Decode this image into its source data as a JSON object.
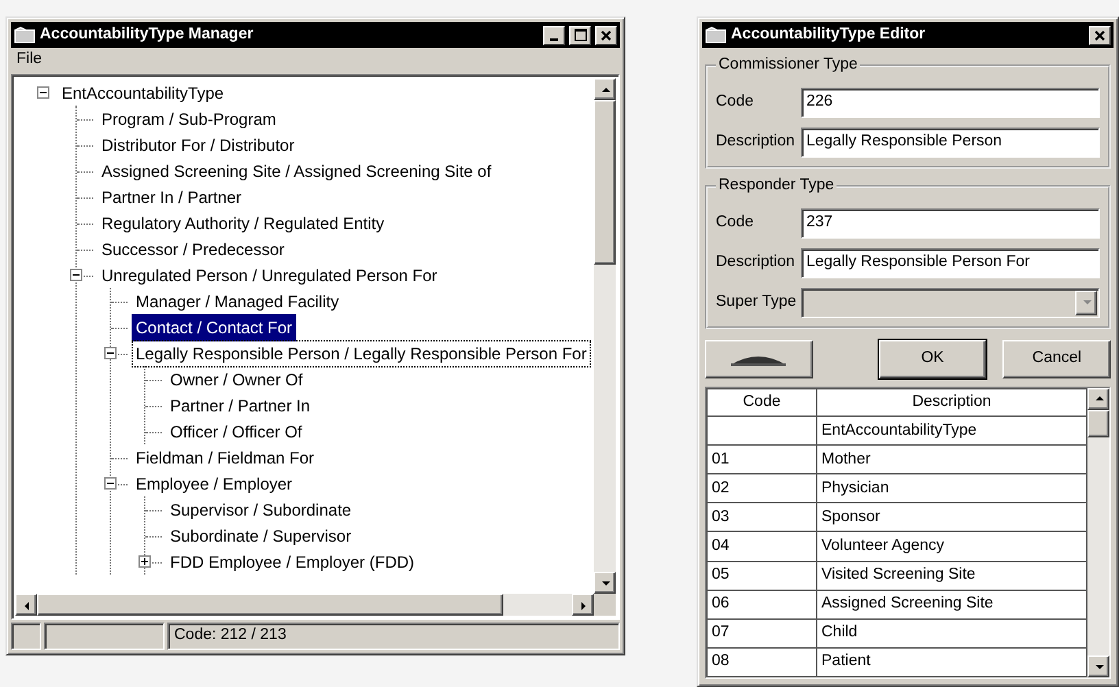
{
  "manager": {
    "title": "AccountabilityType Manager",
    "menu": [
      "File"
    ],
    "tree": [
      {
        "label": "EntAccountabilityType",
        "expanded": true,
        "selected": false,
        "focused": false,
        "children": [
          {
            "label": "Program / Sub-Program",
            "selected": false,
            "focused": false
          },
          {
            "label": "Distributor For / Distributor",
            "selected": false,
            "focused": false
          },
          {
            "label": "Assigned Screening Site / Assigned Screening Site of",
            "selected": false,
            "focused": false
          },
          {
            "label": "Partner In / Partner",
            "selected": false,
            "focused": false
          },
          {
            "label": "Regulatory Authority / Regulated Entity",
            "selected": false,
            "focused": false
          },
          {
            "label": "Successor / Predecessor",
            "selected": false,
            "focused": false
          },
          {
            "label": "Unregulated Person / Unregulated Person For",
            "expanded": true,
            "selected": false,
            "focused": false,
            "children": [
              {
                "label": "Manager / Managed Facility",
                "selected": false,
                "focused": false
              },
              {
                "label": "Contact / Contact For",
                "selected": true,
                "focused": false
              },
              {
                "label": "Legally Responsible Person / Legally Responsible Person For",
                "expanded": true,
                "selected": false,
                "focused": true,
                "children": [
                  {
                    "label": "Owner / Owner Of",
                    "selected": false,
                    "focused": false
                  },
                  {
                    "label": "Partner / Partner In",
                    "selected": false,
                    "focused": false
                  },
                  {
                    "label": "Officer / Officer Of",
                    "selected": false,
                    "focused": false
                  }
                ]
              },
              {
                "label": "Fieldman / Fieldman For",
                "selected": false,
                "focused": false
              },
              {
                "label": "Employee / Employer",
                "expanded": true,
                "selected": false,
                "focused": false,
                "children": [
                  {
                    "label": "Supervisor / Subordinate",
                    "selected": false,
                    "focused": false
                  },
                  {
                    "label": "Subordinate / Supervisor",
                    "selected": false,
                    "focused": false
                  },
                  {
                    "label": "FDD Employee / Employer (FDD)",
                    "expanded": false,
                    "selected": false,
                    "focused": false
                  }
                ]
              }
            ]
          }
        ]
      }
    ],
    "status_bar": {
      "code": "Code: 212 / 213"
    }
  },
  "editor": {
    "title": "AccountabilityType Editor",
    "groups": [
      {
        "legend": "Commissioner Type",
        "fields": [
          {
            "kind": "text",
            "label": "Code",
            "value": "226"
          },
          {
            "kind": "text",
            "label": "Description",
            "value": "Legally Responsible Person"
          }
        ]
      },
      {
        "legend": "Responder Type",
        "fields": [
          {
            "kind": "text",
            "label": "Code",
            "value": "237"
          },
          {
            "kind": "text",
            "label": "Description",
            "value": "Legally Responsible Person For"
          },
          {
            "kind": "dropdown",
            "label": "Super Type",
            "disabled": true
          }
        ]
      }
    ],
    "buttons": [
      {
        "kind": "icon",
        "default": false
      },
      {
        "kind": "text",
        "label": "OK",
        "default": true
      },
      {
        "kind": "text",
        "label": "Cancel",
        "default": false
      }
    ],
    "table": {
      "columns": [
        "Code",
        "Description"
      ],
      "rows": [
        {
          "description": "EntAccountabilityType"
        },
        {
          "code": "01",
          "description": "Mother"
        },
        {
          "code": "02",
          "description": "Physician"
        },
        {
          "code": "03",
          "description": "Sponsor"
        },
        {
          "code": "04",
          "description": "Volunteer Agency"
        },
        {
          "code": "05",
          "description": "Visited Screening Site"
        },
        {
          "code": "06",
          "description": "Assigned Screening Site"
        },
        {
          "code": "07",
          "description": "Child"
        },
        {
          "code": "08",
          "description": "Patient"
        }
      ]
    }
  }
}
